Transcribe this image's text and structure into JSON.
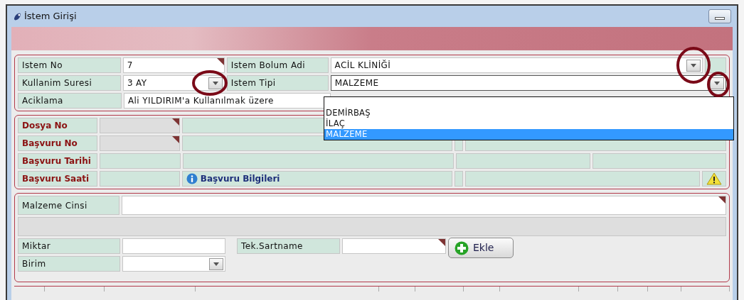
{
  "window": {
    "title": "İstem Girişi"
  },
  "request": {
    "istem_no": {
      "label": "Istem No",
      "value": "7",
      "required": true
    },
    "bolum": {
      "label": "Istem Bolum Adi",
      "value": "ACİL KLİNİĞİ"
    },
    "kullanim": {
      "label": "Kullanim Suresi",
      "value": "3 AY"
    },
    "tipi": {
      "label": "Istem Tipi",
      "value": "MALZEME",
      "expanded": true,
      "options": [
        {
          "label": "DEMİRBAŞ",
          "selected": false
        },
        {
          "label": "İLAÇ",
          "selected": false
        },
        {
          "label": "MALZEME",
          "selected": true
        }
      ]
    },
    "aciklama": {
      "label": "Aciklama",
      "value": "Ali YILDIRIM'a Kullanılmak üzere"
    }
  },
  "patient": {
    "rows": [
      {
        "label": "Dosya No",
        "required": true
      },
      {
        "label": "Başvuru No",
        "required": true
      },
      {
        "label": "Başvuru Tarihi",
        "required": false
      },
      {
        "label": "Başvuru Saati",
        "required": false
      }
    ],
    "info_link": "Başvuru Bilgileri"
  },
  "item": {
    "malzeme": {
      "label": "Malzeme Cinsi",
      "required": true
    },
    "miktar": {
      "label": "Miktar"
    },
    "sartname": {
      "label": "Tek.Sartname",
      "required": true
    },
    "birim": {
      "label": "Birim"
    },
    "add_button": "Ekle"
  }
}
